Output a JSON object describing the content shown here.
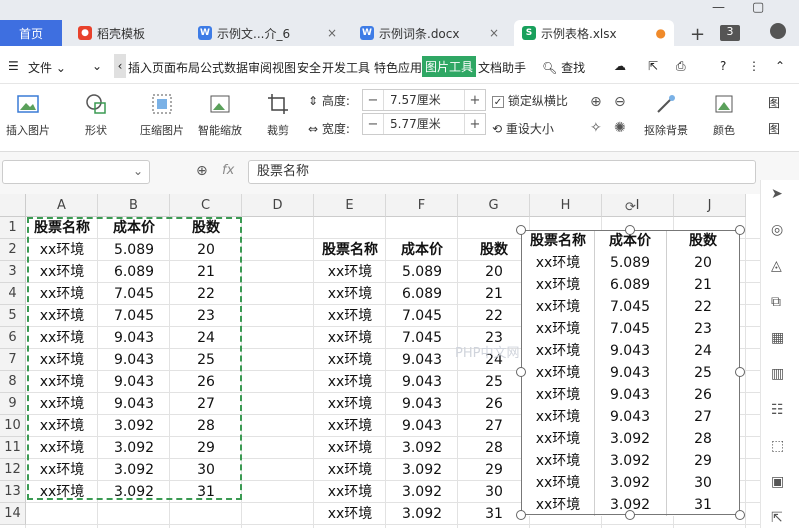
{
  "tabs": {
    "home": "首页",
    "items": [
      {
        "label": "稻壳模板",
        "icon": "docer-icon",
        "color": "#e8412c"
      },
      {
        "label": "示例文...介_6",
        "icon": "word-doc-icon",
        "color": "#3e7ce6"
      },
      {
        "label": "示例词条.docx",
        "icon": "word-doc-icon",
        "color": "#3e7ce6"
      },
      {
        "label": "示例表格.xlsx",
        "icon": "excel-sheet-icon",
        "color": "#19a05c"
      }
    ],
    "new_tab": "+",
    "tab_count": "3"
  },
  "menu": {
    "file": "文件",
    "items": [
      "插入",
      "页面布局",
      "公式",
      "数据",
      "审阅",
      "视图",
      "安全",
      "开发工具",
      "特色应用",
      "图片工具",
      "文档助手"
    ],
    "active": "图片工具",
    "search": "查找"
  },
  "ribbon": {
    "insert_picture": "插入图片",
    "shape": "形状",
    "compress_picture": "压缩图片",
    "smart_zoom": "智能缩放",
    "crop": "裁剪",
    "height_label": "高度:",
    "height_value": "7.57厘米",
    "width_label": "宽度:",
    "width_value": "5.77厘米",
    "lock_ratio": "锁定纵横比",
    "reset_size": "重设大小",
    "remove_bg": "抠除背景",
    "color": "颜色",
    "more": "图"
  },
  "formula_bar": {
    "fx": "fx",
    "content": "股票名称"
  },
  "sheet": {
    "columns": [
      "A",
      "B",
      "C",
      "D",
      "E",
      "F",
      "G",
      "H",
      "I",
      "J"
    ],
    "rows": [
      "1",
      "2",
      "3",
      "4",
      "5",
      "6",
      "7",
      "8",
      "9",
      "10",
      "11",
      "12",
      "13",
      "14"
    ],
    "headers": [
      "股票名称",
      "成本价",
      "股数"
    ],
    "names": [
      "xx环境",
      "xx环境",
      "xx环境",
      "xx环境",
      "xx环境",
      "xx环境",
      "xx环境",
      "xx环境",
      "xx环境",
      "xx环境",
      "xx环境",
      "xx环境"
    ],
    "prices": [
      "5.089",
      "6.089",
      "7.045",
      "7.045",
      "9.043",
      "9.043",
      "9.043",
      "9.043",
      "3.092",
      "3.092",
      "3.092",
      "3.092"
    ],
    "shares": [
      "20",
      "21",
      "22",
      "23",
      "24",
      "25",
      "26",
      "27",
      "28",
      "29",
      "30",
      "31"
    ]
  },
  "watermark": "PHP中文网",
  "colors": {
    "accent": "#3e6fe0",
    "active_menu_bg": "#2fa764",
    "selection_border": "#3a9a52"
  }
}
